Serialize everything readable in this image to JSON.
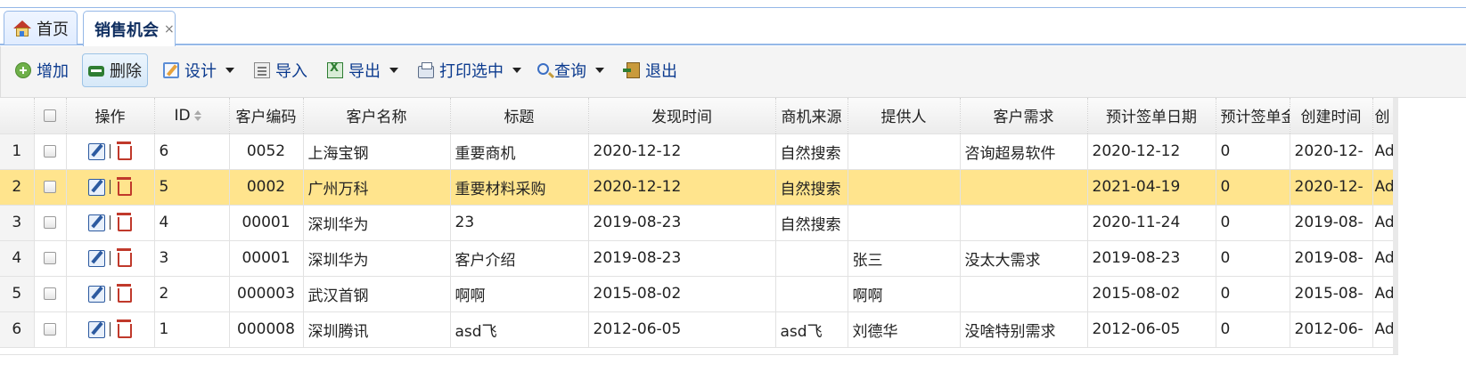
{
  "tabs": [
    {
      "label": "首页",
      "icon": "home-icon"
    },
    {
      "label": "销售机会",
      "close": "×"
    }
  ],
  "toolbar": [
    {
      "label": "增加",
      "icon": "add-icon"
    },
    {
      "label": "删除",
      "icon": "delete-icon"
    },
    {
      "label": "设计",
      "icon": "design-icon"
    },
    {
      "label": "导入",
      "icon": "import-icon"
    },
    {
      "label": "导出",
      "icon": "export-icon"
    },
    {
      "label": "打印选中",
      "icon": "print-icon"
    },
    {
      "label": "查询",
      "icon": "search-icon"
    },
    {
      "label": "退出",
      "icon": "exit-icon"
    }
  ],
  "grid": {
    "headers": [
      "操作",
      "ID",
      "客户编码",
      "客户名称",
      "标题",
      "发现时间",
      "商机来源",
      "提供人",
      "客户需求",
      "预计签单日期",
      "预计签单金",
      "创建时间",
      "创"
    ],
    "rows": [
      {
        "rn": "1",
        "id": "6",
        "code": "0052",
        "name": "上海宝钢",
        "title": "重要商机",
        "found": "2020-12-12",
        "source": "自然搜索",
        "provider": "",
        "need": "咨询超易软件",
        "sign_date": "2020-12-12",
        "amount": "0",
        "created": "2020-12-",
        "creator": "Ad"
      },
      {
        "rn": "2",
        "id": "5",
        "code": "0002",
        "name": "广州万科",
        "title": "重要材料采购",
        "found": "2020-12-12",
        "source": "自然搜索",
        "provider": "",
        "need": "",
        "sign_date": "2021-04-19",
        "amount": "0",
        "created": "2020-12-",
        "creator": "Ad"
      },
      {
        "rn": "3",
        "id": "4",
        "code": "00001",
        "name": "深圳华为",
        "title": "23",
        "found": "2019-08-23",
        "source": "自然搜索",
        "provider": "",
        "need": "",
        "sign_date": "2020-11-24",
        "amount": "0",
        "created": "2019-08-",
        "creator": "Ad"
      },
      {
        "rn": "4",
        "id": "3",
        "code": "00001",
        "name": "深圳华为",
        "title": "客户介绍",
        "found": "2019-08-23",
        "source": "",
        "provider": "张三",
        "need": "没太大需求",
        "sign_date": "2019-08-23",
        "amount": "0",
        "created": "2019-08-",
        "creator": "Ad"
      },
      {
        "rn": "5",
        "id": "2",
        "code": "000003",
        "name": "武汉首钢",
        "title": "啊啊",
        "found": "2015-08-02",
        "source": "",
        "provider": "啊啊",
        "need": "",
        "sign_date": "2015-08-02",
        "amount": "0",
        "created": "2015-08-",
        "creator": "Ad"
      },
      {
        "rn": "6",
        "id": "1",
        "code": "000008",
        "name": "深圳腾讯",
        "title": "asd飞",
        "found": "2012-06-05",
        "source": "asd飞",
        "provider": "刘德华",
        "need": "没啥特别需求",
        "sign_date": "2012-06-05",
        "amount": "0",
        "created": "2012-06-",
        "creator": "Ad"
      }
    ],
    "highlight_color": "#ffe48d"
  }
}
